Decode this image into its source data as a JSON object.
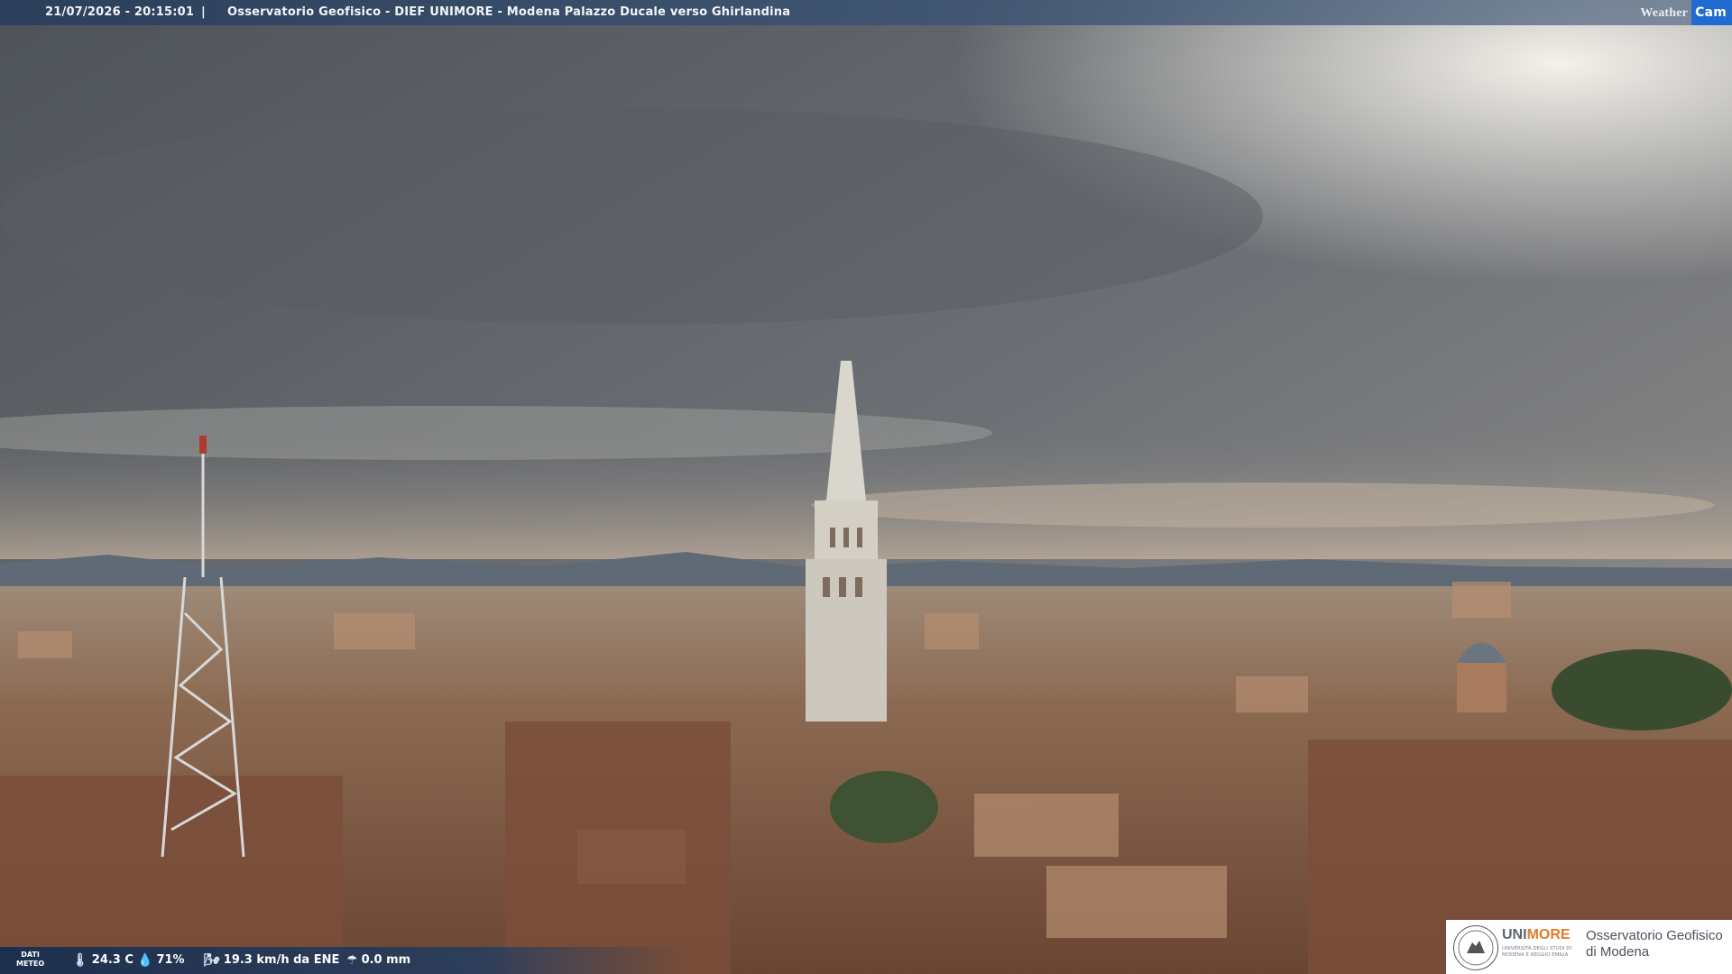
{
  "header": {
    "timestamp": "21/07/2026 - 20:15:01",
    "separator": "|",
    "title": "Osservatorio Geofisico - DIEF UNIMORE - Modena Palazzo Ducale verso Ghirlandina",
    "brand_weather": "Weather",
    "brand_cam": "Cam"
  },
  "weather": {
    "label_line1": "DATI",
    "label_line2": "METEO",
    "temperature": "24.3 C",
    "humidity": "71%",
    "wind": "19.3 km/h da ENE",
    "rain": "0.0 mm"
  },
  "logo": {
    "uni": "UNI",
    "more": "MORE",
    "university_line": "UNIVERSITÀ DEGLI STUDI DI MODENA E REGGIO EMILIA",
    "observatory_line1": "Osservatorio Geofisico",
    "observatory_line2": "di Modena"
  },
  "colors": {
    "brand_blue": "#1f6bd1",
    "unimore_orange": "#e7782a",
    "bar_blue": "#283e5c"
  }
}
